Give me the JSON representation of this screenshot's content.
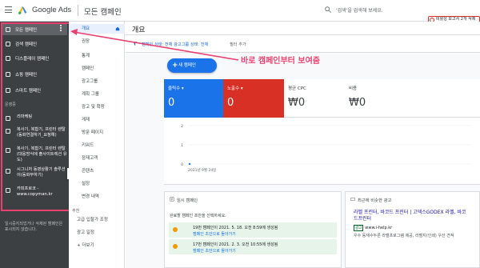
{
  "app": {
    "brand": "Google Ads",
    "page_title": "모든 캠페인",
    "search_placeholder": "'검색'을 검색해 보세요.",
    "alert": "비활성 보고서 2개 삭제"
  },
  "sidebar": {
    "items": [
      {
        "label": "모든 캠페인",
        "icon": "grid-icon"
      },
      {
        "label": "검색 캠페인",
        "icon": "search-icon"
      },
      {
        "label": "디스플레이 캠페인",
        "icon": "display-icon"
      },
      {
        "label": "쇼핑 캠페인",
        "icon": "shopping-icon"
      },
      {
        "label": "스마트 캠페인",
        "icon": "smart-icon"
      }
    ],
    "section_label": "운영중",
    "running": [
      {
        "label": "리마케팅",
        "icon": "display-icon"
      },
      {
        "label": "복사기, 복합기, 프린터 렌탈(동화연결하기_요청예)",
        "icon": "display-icon"
      },
      {
        "label": "복사기, 복합기, 프린터 렌탈(대응방식에 출사이트렉션 유도)",
        "icon": "display-icon"
      },
      {
        "label": "시그니처 동영상활기 솔루션이(동화부하기)",
        "icon": "display-icon"
      },
      {
        "label": "카피프로코 - www.copyman.kr",
        "icon": "search-icon"
      }
    ],
    "footer": "일시중지되었거나 삭제된 캠페인은 표시되지 않습니다."
  },
  "nav": {
    "items": [
      "개요",
      "권장",
      "통계",
      "캠페인",
      "광고그룹",
      "계획 그룹",
      "광고 및 확장",
      "게재",
      "방문 페이지",
      "키워드",
      "잠재고객",
      "콘텐츠",
      "설정",
      "변경 내역"
    ],
    "sub_label": "추천",
    "sub_items": [
      "고급 입찰가 조정",
      "광고 일정",
      "+ 더보기"
    ]
  },
  "filter": {
    "text": "캠페인 상태: 전체 광고그룹 상태: 전체",
    "add": "필터 추가"
  },
  "main": {
    "title": "개요",
    "new_campaign": "새 캠페인",
    "annotation": "바로 캠페인부터 보여줌"
  },
  "metrics": [
    {
      "label": "클릭수 ▾",
      "value": "0"
    },
    {
      "label": "노출수 ▾",
      "value": "0"
    },
    {
      "label": "평균 CPC",
      "value": "₩0"
    },
    {
      "label": "비용",
      "value": "₩0"
    }
  ],
  "chart_data": {
    "type": "line",
    "x": [
      "2021년 9월 24일"
    ],
    "y_ticks": [
      "2",
      "1",
      "0"
    ],
    "series": [
      {
        "name": "",
        "values": [
          0
        ]
      }
    ]
  },
  "recent": {
    "title": "임시 캠페인",
    "subtitle": "완료할 캠페인 초안을 선택하세요.",
    "rows": [
      {
        "line1": "19번 캠페인이 2021. 5. 18. 오전 8:59에 생성됨",
        "line2": "캠페인 초안으로 돌아가기"
      },
      {
        "line1": "17번 캠페인이 2021. 2. 3. 오전 10:55에 생성됨",
        "line2": "캠페인 초안으로 돌아가기"
      }
    ]
  },
  "ad_panel": {
    "title": "최근에 비슷한 광고",
    "ad_title": "라벨 프린터, 바코드 프린터 | 고덱스GODEX 라벨, 바코드프린터",
    "ad_badge": "광고",
    "ad_url": "www.i-help.kr",
    "ad_desc": "우수 동재수두른 라벨프로그램 제공, 라벨지(인쇄) 우산 견적"
  }
}
